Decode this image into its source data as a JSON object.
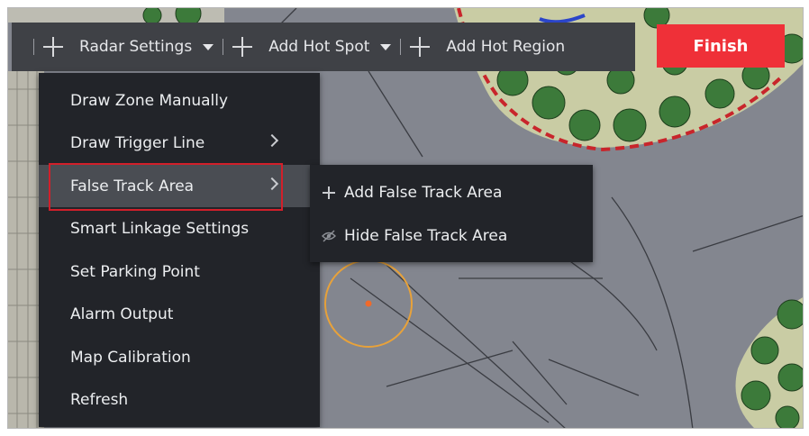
{
  "toolbar": {
    "radar_settings_label": "Radar Settings",
    "add_hot_spot_label": "Add Hot Spot",
    "add_hot_region_label": "Add Hot Region",
    "finish_label": "Finish"
  },
  "menu": {
    "items": [
      {
        "label": "Draw Zone Manually"
      },
      {
        "label": "Draw Trigger Line"
      },
      {
        "label": "False Track Area"
      },
      {
        "label": "Smart Linkage Settings"
      },
      {
        "label": "Set Parking Point"
      },
      {
        "label": "Alarm Output"
      },
      {
        "label": "Map Calibration"
      },
      {
        "label": "Refresh"
      }
    ]
  },
  "submenu": {
    "items": [
      {
        "label": "Add False Track Area",
        "icon": "plus-icon"
      },
      {
        "label": "Hide False Track Area",
        "icon": "eye-hidden-icon"
      }
    ]
  },
  "colors": {
    "toolbar_bg": "#3f4146",
    "menu_bg": "#222429",
    "finish_bg": "#ef3038",
    "highlight_border": "#d21f2a",
    "radar_circle": "#e8a23a"
  }
}
